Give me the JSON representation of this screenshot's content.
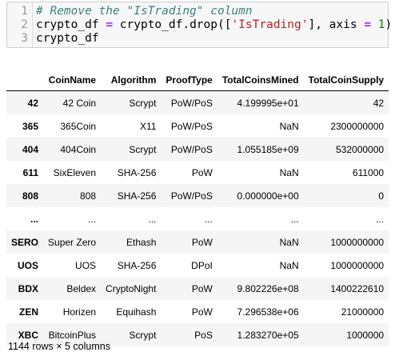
{
  "code_cell": {
    "lines": [
      {
        "num": "1",
        "parts": [
          {
            "cls": "cm",
            "text": "# Remove the \"IsTrading\" column"
          }
        ]
      },
      {
        "num": "2",
        "parts": [
          {
            "cls": "",
            "text": "crypto_df "
          },
          {
            "cls": "op",
            "text": "="
          },
          {
            "cls": "",
            "text": " crypto_df.drop(["
          },
          {
            "cls": "st",
            "text": "'IsTrading'"
          },
          {
            "cls": "",
            "text": "], axis "
          },
          {
            "cls": "op",
            "text": "="
          },
          {
            "cls": "",
            "text": " "
          },
          {
            "cls": "nm",
            "text": "1"
          },
          {
            "cls": "",
            "text": ")"
          }
        ]
      },
      {
        "num": "3",
        "parts": [
          {
            "cls": "",
            "text": "crypto_df"
          }
        ]
      }
    ]
  },
  "dataframe": {
    "columns": [
      "",
      "CoinName",
      "Algorithm",
      "ProofType",
      "TotalCoinsMined",
      "TotalCoinSupply"
    ],
    "rows": [
      {
        "index": "42",
        "values": [
          "42 Coin",
          "Scrypt",
          "PoW/PoS",
          "4.199995e+01",
          "42"
        ]
      },
      {
        "index": "365",
        "values": [
          "365Coin",
          "X11",
          "PoW/PoS",
          "NaN",
          "2300000000"
        ]
      },
      {
        "index": "404",
        "values": [
          "404Coin",
          "Scrypt",
          "PoW/PoS",
          "1.055185e+09",
          "532000000"
        ]
      },
      {
        "index": "611",
        "values": [
          "SixEleven",
          "SHA-256",
          "PoW",
          "NaN",
          "611000"
        ]
      },
      {
        "index": "808",
        "values": [
          "808",
          "SHA-256",
          "PoW/PoS",
          "0.000000e+00",
          "0"
        ]
      },
      {
        "index": "...",
        "values": [
          "...",
          "...",
          "...",
          "...",
          "..."
        ],
        "ellipsis": true
      },
      {
        "index": "SERO",
        "values": [
          "Super Zero",
          "Ethash",
          "PoW",
          "NaN",
          "1000000000"
        ]
      },
      {
        "index": "UOS",
        "values": [
          "UOS",
          "SHA-256",
          "DPoI",
          "NaN",
          "1000000000"
        ]
      },
      {
        "index": "BDX",
        "values": [
          "Beldex",
          "CryptoNight",
          "PoW",
          "9.802226e+08",
          "1400222610"
        ]
      },
      {
        "index": "ZEN",
        "values": [
          "Horizen",
          "Equihash",
          "PoW",
          "7.296538e+06",
          "21000000"
        ]
      },
      {
        "index": "XBC",
        "values": [
          "BitcoinPlus",
          "Scrypt",
          "PoS",
          "1.283270e+05",
          "1000000"
        ]
      }
    ],
    "shape_text": "1144 rows × 5 columns"
  }
}
